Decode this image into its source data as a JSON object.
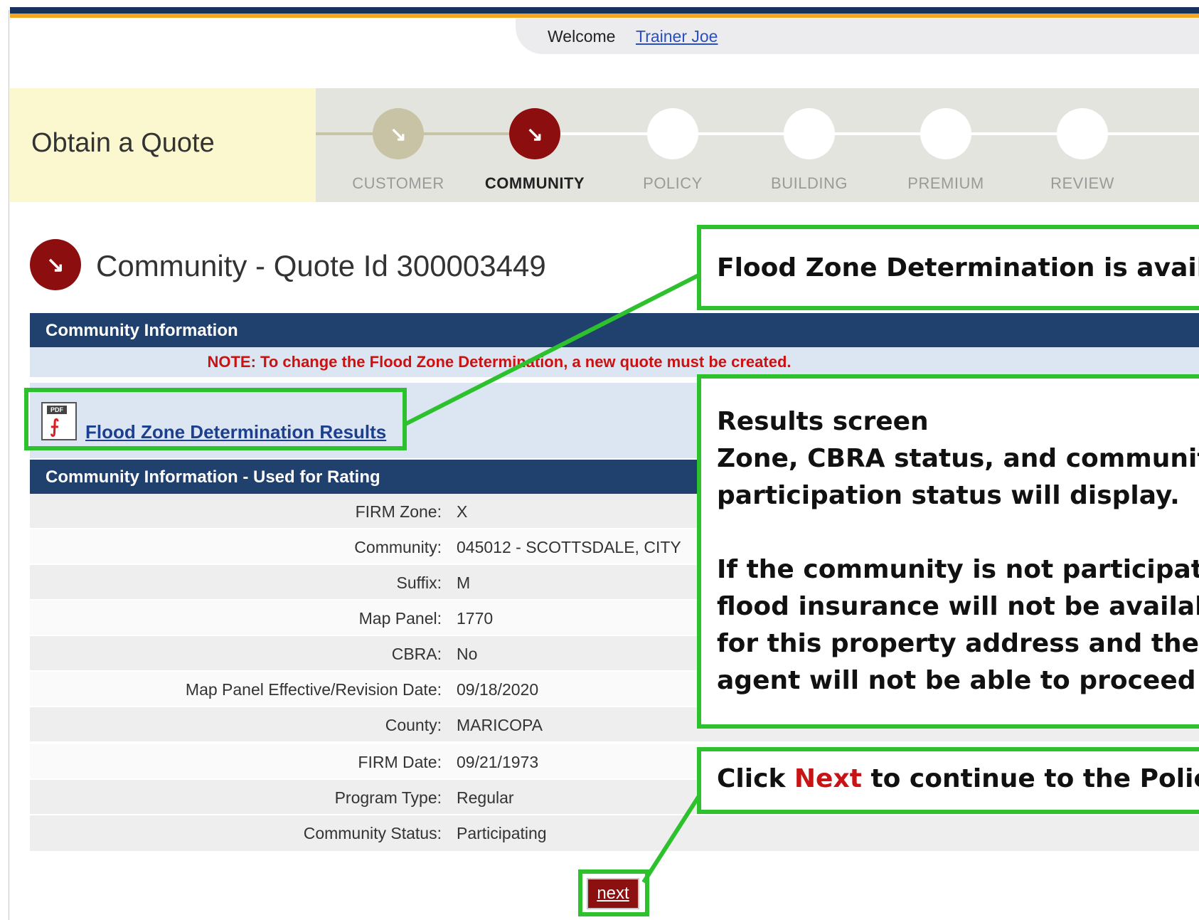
{
  "header": {
    "welcome_label": "Welcome",
    "user_name": "Trainer Joe"
  },
  "quote": {
    "title": "Obtain a Quote"
  },
  "steps": [
    {
      "label": "CUSTOMER",
      "state": "completed"
    },
    {
      "label": "COMMUNITY",
      "state": "active"
    },
    {
      "label": "POLICY",
      "state": "pending"
    },
    {
      "label": "BUILDING",
      "state": "pending"
    },
    {
      "label": "PREMIUM",
      "state": "pending"
    },
    {
      "label": "REVIEW",
      "state": "pending"
    }
  ],
  "page": {
    "title": "Community - Quote Id 300003449"
  },
  "community_info": {
    "header": "Community Information",
    "note": "NOTE: To change the Flood Zone Determination, a new quote must be created.",
    "pdf_icon_label": "PDF",
    "pdf_link": "Flood Zone Determination Results"
  },
  "rating": {
    "header": "Community Information - Used for Rating",
    "rows": [
      {
        "label": "FIRM Zone:",
        "value": "X"
      },
      {
        "label": "Community:",
        "value": "045012  - SCOTTSDALE, CITY"
      },
      {
        "label": "Suffix:",
        "value": "M"
      },
      {
        "label": "Map Panel:",
        "value": "1770"
      },
      {
        "label": "CBRA:",
        "value": "No"
      },
      {
        "label": "Map Panel Effective/Revision Date:",
        "value": "09/18/2020"
      },
      {
        "label": "County:",
        "value": "MARICOPA"
      },
      {
        "label": "FIRM Date:",
        "value": "09/21/1973"
      },
      {
        "label": "Program Type:",
        "value": "Regular"
      },
      {
        "label": "Community Status:",
        "value": "Participating"
      }
    ]
  },
  "actions": {
    "next_label": "next"
  },
  "callouts": {
    "flood_zone": "Flood Zone Determination is availab",
    "results_lines": [
      "Results screen",
      "Zone, CBRA status, and community",
      "participation status will display.",
      "If the community is not participatin",
      "flood insurance will not be available",
      "for this property address and the",
      "agent will not be able to proceed"
    ],
    "next_prefix": "Click ",
    "next_keyword": "Next",
    "next_suffix": " to continue to the Policy scre"
  },
  "colors": {
    "navy": "#20406e",
    "accent_orange": "#f2a51f",
    "active_step": "#8c0e0e",
    "completed_step": "#c7c3a4",
    "callout_green": "#2ec12e",
    "note_red": "#cc1111"
  }
}
